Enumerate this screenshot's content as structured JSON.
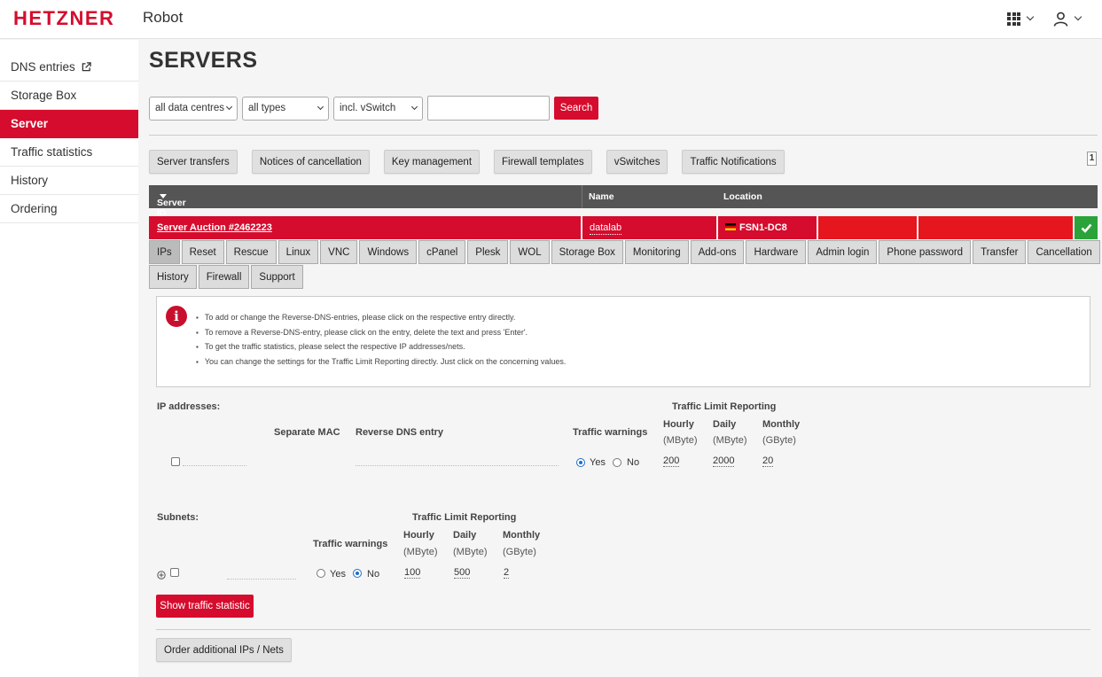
{
  "header": {
    "logo": "HETZNER",
    "product": "Robot",
    "apps_icon": "grid-icon",
    "account_icon": "user-icon"
  },
  "sidebar": {
    "items": [
      {
        "label": "DNS entries",
        "icon": "external-link-icon"
      },
      {
        "label": "Storage Box"
      },
      {
        "label": "Server",
        "active": true
      },
      {
        "label": "Traffic statistics"
      },
      {
        "label": "History"
      },
      {
        "label": "Ordering"
      }
    ]
  },
  "page": {
    "title": "SERVERS"
  },
  "filters": {
    "datacentre": "all data centres",
    "type": "all types",
    "vswitch": "incl. vSwitch",
    "search_value": "",
    "search_button": "Search"
  },
  "actions": [
    "Server transfers",
    "Notices of cancellation",
    "Key management",
    "Firewall templates",
    "vSwitches",
    "Traffic Notifications"
  ],
  "pager": {
    "page": "1"
  },
  "table": {
    "headers": {
      "server_id": "Server ID",
      "name": "Name",
      "location": "Location"
    },
    "row": {
      "server_id": "Server Auction #2462223",
      "name": "datalab",
      "location": "FSN1-DC8",
      "status": "ok"
    }
  },
  "tabs_row1": [
    "IPs",
    "Reset",
    "Rescue",
    "Linux",
    "VNC",
    "Windows",
    "cPanel",
    "Plesk",
    "WOL",
    "Storage Box",
    "Monitoring",
    "Add-ons",
    "Hardware",
    "Admin login",
    "Phone password",
    "Transfer",
    "Cancellation"
  ],
  "tabs_row2": [
    "History",
    "Firewall",
    "Support"
  ],
  "info": [
    "To add or change the Reverse-DNS-entries, please click on the respective entry directly.",
    "To remove a Reverse-DNS-entry, please click on the entry, delete the text and press 'Enter'.",
    "To get the traffic statistics, please select the respective IP addresses/nets.",
    "You can change the settings for the Traffic Limit Reporting directly. Just click on the concerning values."
  ],
  "ip_section": {
    "title": "IP addresses:",
    "traffic_limit_title": "Traffic Limit Reporting",
    "col_mac": "Separate MAC",
    "col_rdns": "Reverse DNS entry",
    "col_warnings": "Traffic warnings",
    "col_hourly": "Hourly",
    "col_daily": "Daily",
    "col_monthly": "Monthly",
    "unit_mbyte": "(MByte)",
    "unit_gbyte": "(GByte)",
    "yes": "Yes",
    "no": "No",
    "warnings": "yes",
    "hourly": "200",
    "daily": "2000",
    "monthly": "20"
  },
  "subnet_section": {
    "title": "Subnets:",
    "traffic_limit_title": "Traffic Limit Reporting",
    "col_warnings": "Traffic warnings",
    "col_hourly": "Hourly",
    "col_daily": "Daily",
    "col_monthly": "Monthly",
    "unit_mbyte": "(MByte)",
    "unit_gbyte": "(GByte)",
    "yes": "Yes",
    "no": "No",
    "warnings": "no",
    "hourly": "100",
    "daily": "500",
    "monthly": "2"
  },
  "buttons": {
    "show_traffic": "Show traffic statistic",
    "order_ips": "Order additional IPs / Nets"
  },
  "colors": {
    "brand_red": "#d50c2d",
    "status_green": "#2aa33a",
    "header_dark": "#555555"
  }
}
